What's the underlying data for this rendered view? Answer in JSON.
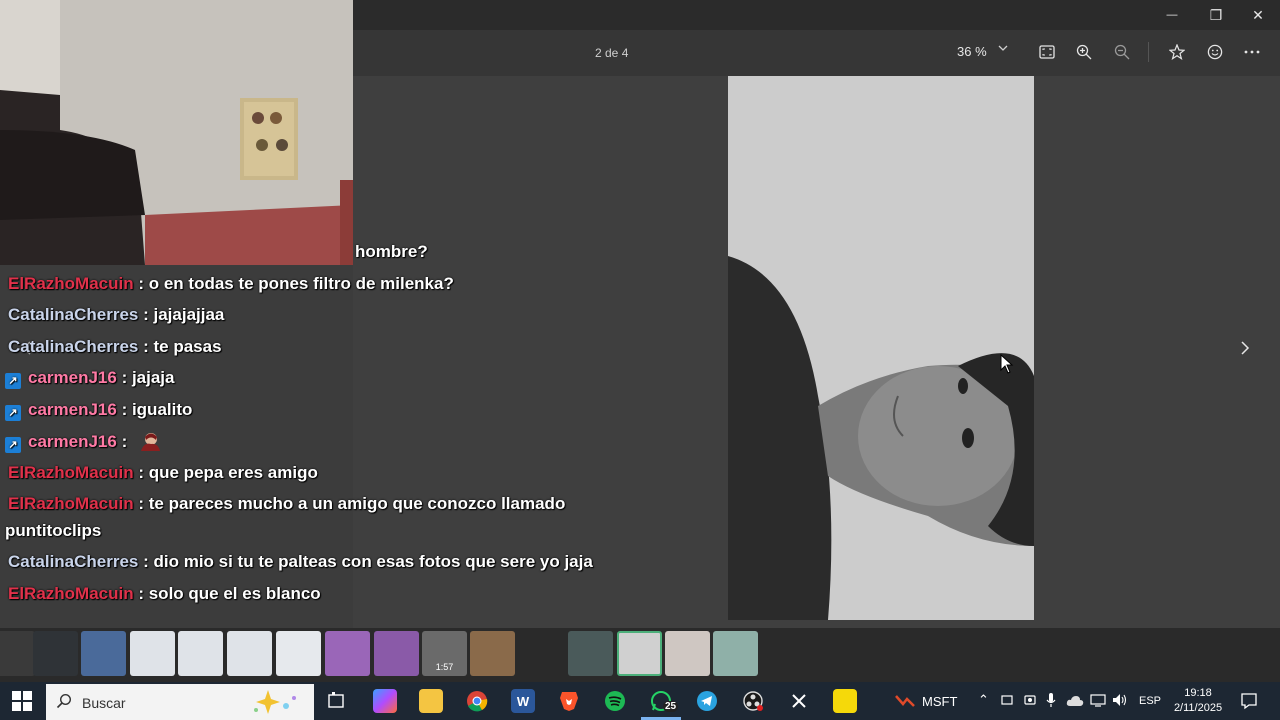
{
  "window": {
    "minimize": "—",
    "restore": "❐",
    "close": "✕"
  },
  "toolbar": {
    "page_indicator": "2 de 4",
    "zoom_level": "36 %"
  },
  "chat": [
    {
      "user": "",
      "text": "hombre?"
    },
    {
      "user": "ElRazhoMacuin",
      "text": " : o en todas te pones filtro de milenka?"
    },
    {
      "user": "CatalinaCherres",
      "text": " : jajajajjaa"
    },
    {
      "user": "CatalinaCherres",
      "text": " : te pasas"
    },
    {
      "user": "carmenJ16",
      "text": " : jajaja"
    },
    {
      "user": "carmenJ16",
      "text": " : igualito"
    },
    {
      "user": "carmenJ16",
      "text": " :"
    },
    {
      "user": "ElRazhoMacuin",
      "text": " : que pepa eres amigo"
    },
    {
      "user": "ElRazhoMacuin",
      "text": " : te pareces mucho a un amigo que conozco llamado"
    },
    {
      "user": "",
      "text": "puntitoclips"
    },
    {
      "user": "CatalinaCherres",
      "text": " : dio mio si tu te palteas con esas fotos que sere yo jaja"
    },
    {
      "user": "ElRazhoMacuin",
      "text": " : solo que el es blanco"
    }
  ],
  "filmstrip": {
    "video_duration": "1:57"
  },
  "taskbar": {
    "search_placeholder": "Buscar",
    "whatsapp_badge": "25",
    "stock_ticker": "MSFT",
    "language": "ESP",
    "time": "19:18",
    "date": "2/11/2025"
  },
  "colors": {
    "user_red": "#e0314a",
    "user_blue": "#c9d4ea",
    "user_pink": "#ff7aa5",
    "badge_blue": "#1c7fd6"
  }
}
